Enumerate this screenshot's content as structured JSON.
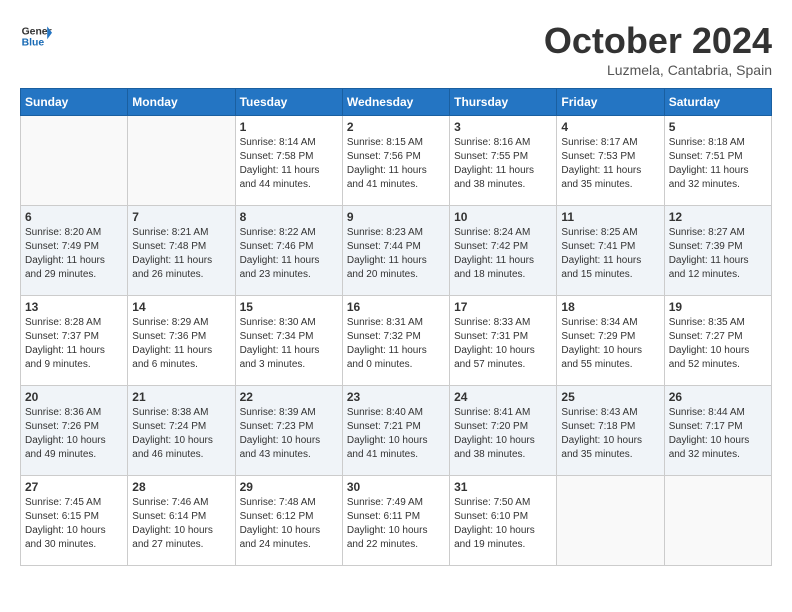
{
  "header": {
    "logo_line1": "General",
    "logo_line2": "Blue",
    "month": "October 2024",
    "location": "Luzmela, Cantabria, Spain"
  },
  "weekdays": [
    "Sunday",
    "Monday",
    "Tuesday",
    "Wednesday",
    "Thursday",
    "Friday",
    "Saturday"
  ],
  "weeks": [
    [
      {
        "day": "",
        "info": ""
      },
      {
        "day": "",
        "info": ""
      },
      {
        "day": "1",
        "info": "Sunrise: 8:14 AM\nSunset: 7:58 PM\nDaylight: 11 hours and 44 minutes."
      },
      {
        "day": "2",
        "info": "Sunrise: 8:15 AM\nSunset: 7:56 PM\nDaylight: 11 hours and 41 minutes."
      },
      {
        "day": "3",
        "info": "Sunrise: 8:16 AM\nSunset: 7:55 PM\nDaylight: 11 hours and 38 minutes."
      },
      {
        "day": "4",
        "info": "Sunrise: 8:17 AM\nSunset: 7:53 PM\nDaylight: 11 hours and 35 minutes."
      },
      {
        "day": "5",
        "info": "Sunrise: 8:18 AM\nSunset: 7:51 PM\nDaylight: 11 hours and 32 minutes."
      }
    ],
    [
      {
        "day": "6",
        "info": "Sunrise: 8:20 AM\nSunset: 7:49 PM\nDaylight: 11 hours and 29 minutes."
      },
      {
        "day": "7",
        "info": "Sunrise: 8:21 AM\nSunset: 7:48 PM\nDaylight: 11 hours and 26 minutes."
      },
      {
        "day": "8",
        "info": "Sunrise: 8:22 AM\nSunset: 7:46 PM\nDaylight: 11 hours and 23 minutes."
      },
      {
        "day": "9",
        "info": "Sunrise: 8:23 AM\nSunset: 7:44 PM\nDaylight: 11 hours and 20 minutes."
      },
      {
        "day": "10",
        "info": "Sunrise: 8:24 AM\nSunset: 7:42 PM\nDaylight: 11 hours and 18 minutes."
      },
      {
        "day": "11",
        "info": "Sunrise: 8:25 AM\nSunset: 7:41 PM\nDaylight: 11 hours and 15 minutes."
      },
      {
        "day": "12",
        "info": "Sunrise: 8:27 AM\nSunset: 7:39 PM\nDaylight: 11 hours and 12 minutes."
      }
    ],
    [
      {
        "day": "13",
        "info": "Sunrise: 8:28 AM\nSunset: 7:37 PM\nDaylight: 11 hours and 9 minutes."
      },
      {
        "day": "14",
        "info": "Sunrise: 8:29 AM\nSunset: 7:36 PM\nDaylight: 11 hours and 6 minutes."
      },
      {
        "day": "15",
        "info": "Sunrise: 8:30 AM\nSunset: 7:34 PM\nDaylight: 11 hours and 3 minutes."
      },
      {
        "day": "16",
        "info": "Sunrise: 8:31 AM\nSunset: 7:32 PM\nDaylight: 11 hours and 0 minutes."
      },
      {
        "day": "17",
        "info": "Sunrise: 8:33 AM\nSunset: 7:31 PM\nDaylight: 10 hours and 57 minutes."
      },
      {
        "day": "18",
        "info": "Sunrise: 8:34 AM\nSunset: 7:29 PM\nDaylight: 10 hours and 55 minutes."
      },
      {
        "day": "19",
        "info": "Sunrise: 8:35 AM\nSunset: 7:27 PM\nDaylight: 10 hours and 52 minutes."
      }
    ],
    [
      {
        "day": "20",
        "info": "Sunrise: 8:36 AM\nSunset: 7:26 PM\nDaylight: 10 hours and 49 minutes."
      },
      {
        "day": "21",
        "info": "Sunrise: 8:38 AM\nSunset: 7:24 PM\nDaylight: 10 hours and 46 minutes."
      },
      {
        "day": "22",
        "info": "Sunrise: 8:39 AM\nSunset: 7:23 PM\nDaylight: 10 hours and 43 minutes."
      },
      {
        "day": "23",
        "info": "Sunrise: 8:40 AM\nSunset: 7:21 PM\nDaylight: 10 hours and 41 minutes."
      },
      {
        "day": "24",
        "info": "Sunrise: 8:41 AM\nSunset: 7:20 PM\nDaylight: 10 hours and 38 minutes."
      },
      {
        "day": "25",
        "info": "Sunrise: 8:43 AM\nSunset: 7:18 PM\nDaylight: 10 hours and 35 minutes."
      },
      {
        "day": "26",
        "info": "Sunrise: 8:44 AM\nSunset: 7:17 PM\nDaylight: 10 hours and 32 minutes."
      }
    ],
    [
      {
        "day": "27",
        "info": "Sunrise: 7:45 AM\nSunset: 6:15 PM\nDaylight: 10 hours and 30 minutes."
      },
      {
        "day": "28",
        "info": "Sunrise: 7:46 AM\nSunset: 6:14 PM\nDaylight: 10 hours and 27 minutes."
      },
      {
        "day": "29",
        "info": "Sunrise: 7:48 AM\nSunset: 6:12 PM\nDaylight: 10 hours and 24 minutes."
      },
      {
        "day": "30",
        "info": "Sunrise: 7:49 AM\nSunset: 6:11 PM\nDaylight: 10 hours and 22 minutes."
      },
      {
        "day": "31",
        "info": "Sunrise: 7:50 AM\nSunset: 6:10 PM\nDaylight: 10 hours and 19 minutes."
      },
      {
        "day": "",
        "info": ""
      },
      {
        "day": "",
        "info": ""
      }
    ]
  ]
}
